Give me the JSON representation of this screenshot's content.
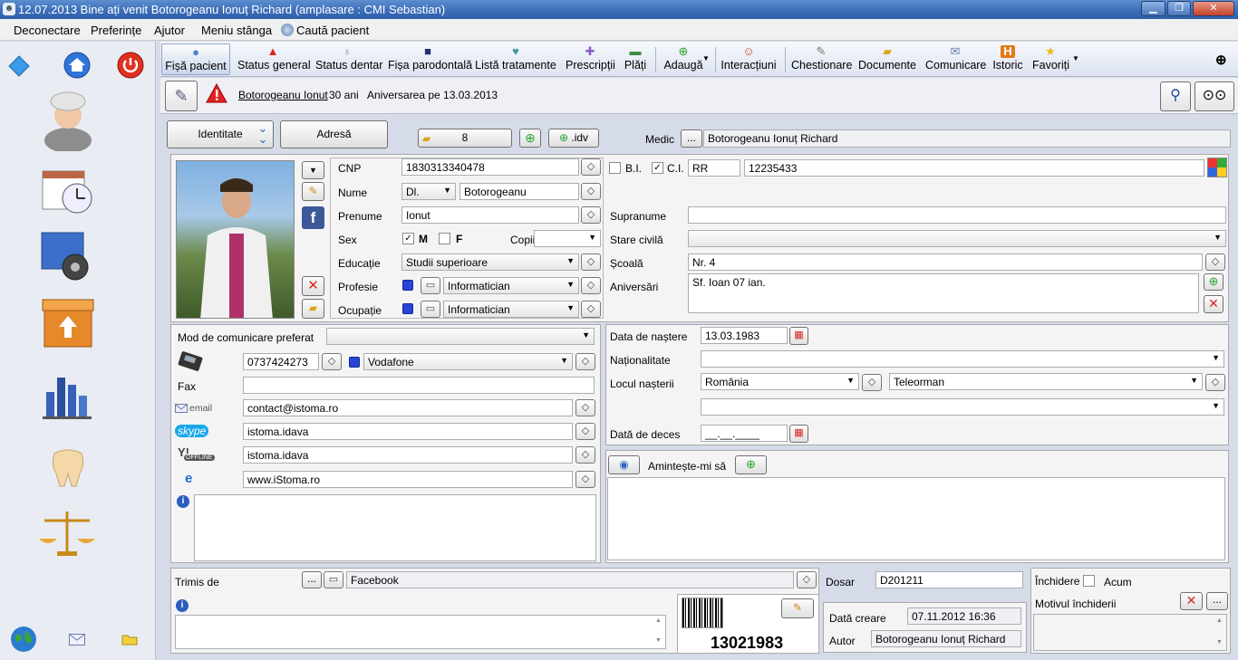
{
  "window": {
    "title": "12.07.2013 Bine ați venit Botorogeanu Ionuț Richard (amplasare : CMI Sebastian)"
  },
  "menu": [
    "Deconectare",
    "Preferințe",
    "Ajutor",
    "Meniu stânga",
    "Caută pacient"
  ],
  "toolbar": [
    {
      "label": "Fișă pacient",
      "icon": "user-icon"
    },
    {
      "label": "Status general",
      "icon": "warning-icon"
    },
    {
      "label": "Status dentar",
      "icon": "tooth-icon"
    },
    {
      "label": "Fișa parodontală",
      "icon": "gum-icon"
    },
    {
      "label": "Listă tratamente",
      "icon": "treatment-icon"
    },
    {
      "label": "Prescripții",
      "icon": "pills-icon"
    },
    {
      "label": "Plăți",
      "icon": "money-icon"
    },
    {
      "label": "Adaugă",
      "icon": "add-icon"
    },
    {
      "label": "Interacțiuni",
      "icon": "people-icon"
    },
    {
      "label": "Chestionare",
      "icon": "questionnaire-icon"
    },
    {
      "label": "Documente",
      "icon": "folder-icon"
    },
    {
      "label": "Comunicare",
      "icon": "mail-icon"
    },
    {
      "label": "Istoric",
      "icon": "history-icon"
    },
    {
      "label": "Favoriți",
      "icon": "star-icon"
    }
  ],
  "patient": {
    "name": "Botorogeanu Ionut",
    "age": "30 ani",
    "anniversary": "Aniversarea pe 13.03.2013"
  },
  "tabs": {
    "identity": "Identitate",
    "address": "Adresă",
    "files_count": "8",
    "idv": ".idv",
    "medic_label": "Medic",
    "medic_btn": "...",
    "medic_name": "Botorogeanu Ionuț Richard"
  },
  "identity": {
    "cnp_label": "CNP",
    "cnp": "1830313340478",
    "bi_label": "B.I.",
    "ci_label": "C.I.",
    "ci_series": "RR",
    "ci_number": "12235433",
    "name_label": "Nume",
    "title": "Dl.",
    "last_name": "Botorogeanu",
    "first_name_label": "Prenume",
    "first_name": "Ionut",
    "nickname_label": "Supranume",
    "nickname": "",
    "sex_label": "Sex",
    "sex_m": "M",
    "sex_f": "F",
    "children_label": "Copii",
    "children": "",
    "civil_label": "Stare civilă",
    "civil": "",
    "education_label": "Educație",
    "education": "Studii superioare",
    "school_label": "Școală",
    "school": "Nr. 4",
    "profession_label": "Profesie",
    "profession": "Informatician",
    "occupation_label": "Ocupație",
    "occupation": "Informatician",
    "anniversaries_label": "Aniversări",
    "anniversaries": "Sf. Ioan 07 ian."
  },
  "contact": {
    "pref_label": "Mod de comunicare preferat",
    "pref": "",
    "phone": "0737424273",
    "operator": "Vodafone",
    "fax_label": "Fax",
    "fax": "",
    "email_label": "email",
    "email": "contact@istoma.ro",
    "skype_label": "skype",
    "skype": "istoma.idava",
    "yahoo_label": "OFFLINE",
    "yahoo": "istoma.idava",
    "web": "www.iStoma.ro"
  },
  "birth": {
    "dob_label": "Data de naștere",
    "dob": "13.03.1983",
    "nationality_label": "Naționalitate",
    "nationality": "",
    "birthplace_label": "Locul nașterii",
    "country": "România",
    "county": "Teleorman",
    "city": "",
    "death_label": "Dată de deces",
    "death": "__.__.____"
  },
  "reminder": {
    "label": "Amintește-mi să"
  },
  "bottom": {
    "referred_label": "Trimis de",
    "referred": "Facebook",
    "dossier_label": "Dosar",
    "dossier": "D201211",
    "barcode": "13021983",
    "created_label": "Dată creare",
    "created": "07.11.2012 16:36",
    "author_label": "Autor",
    "author": "Botorogeanu Ionuț Richard",
    "close_label": "Închidere",
    "now_label": "Acum",
    "close_reason_label": "Motivul închiderii"
  }
}
